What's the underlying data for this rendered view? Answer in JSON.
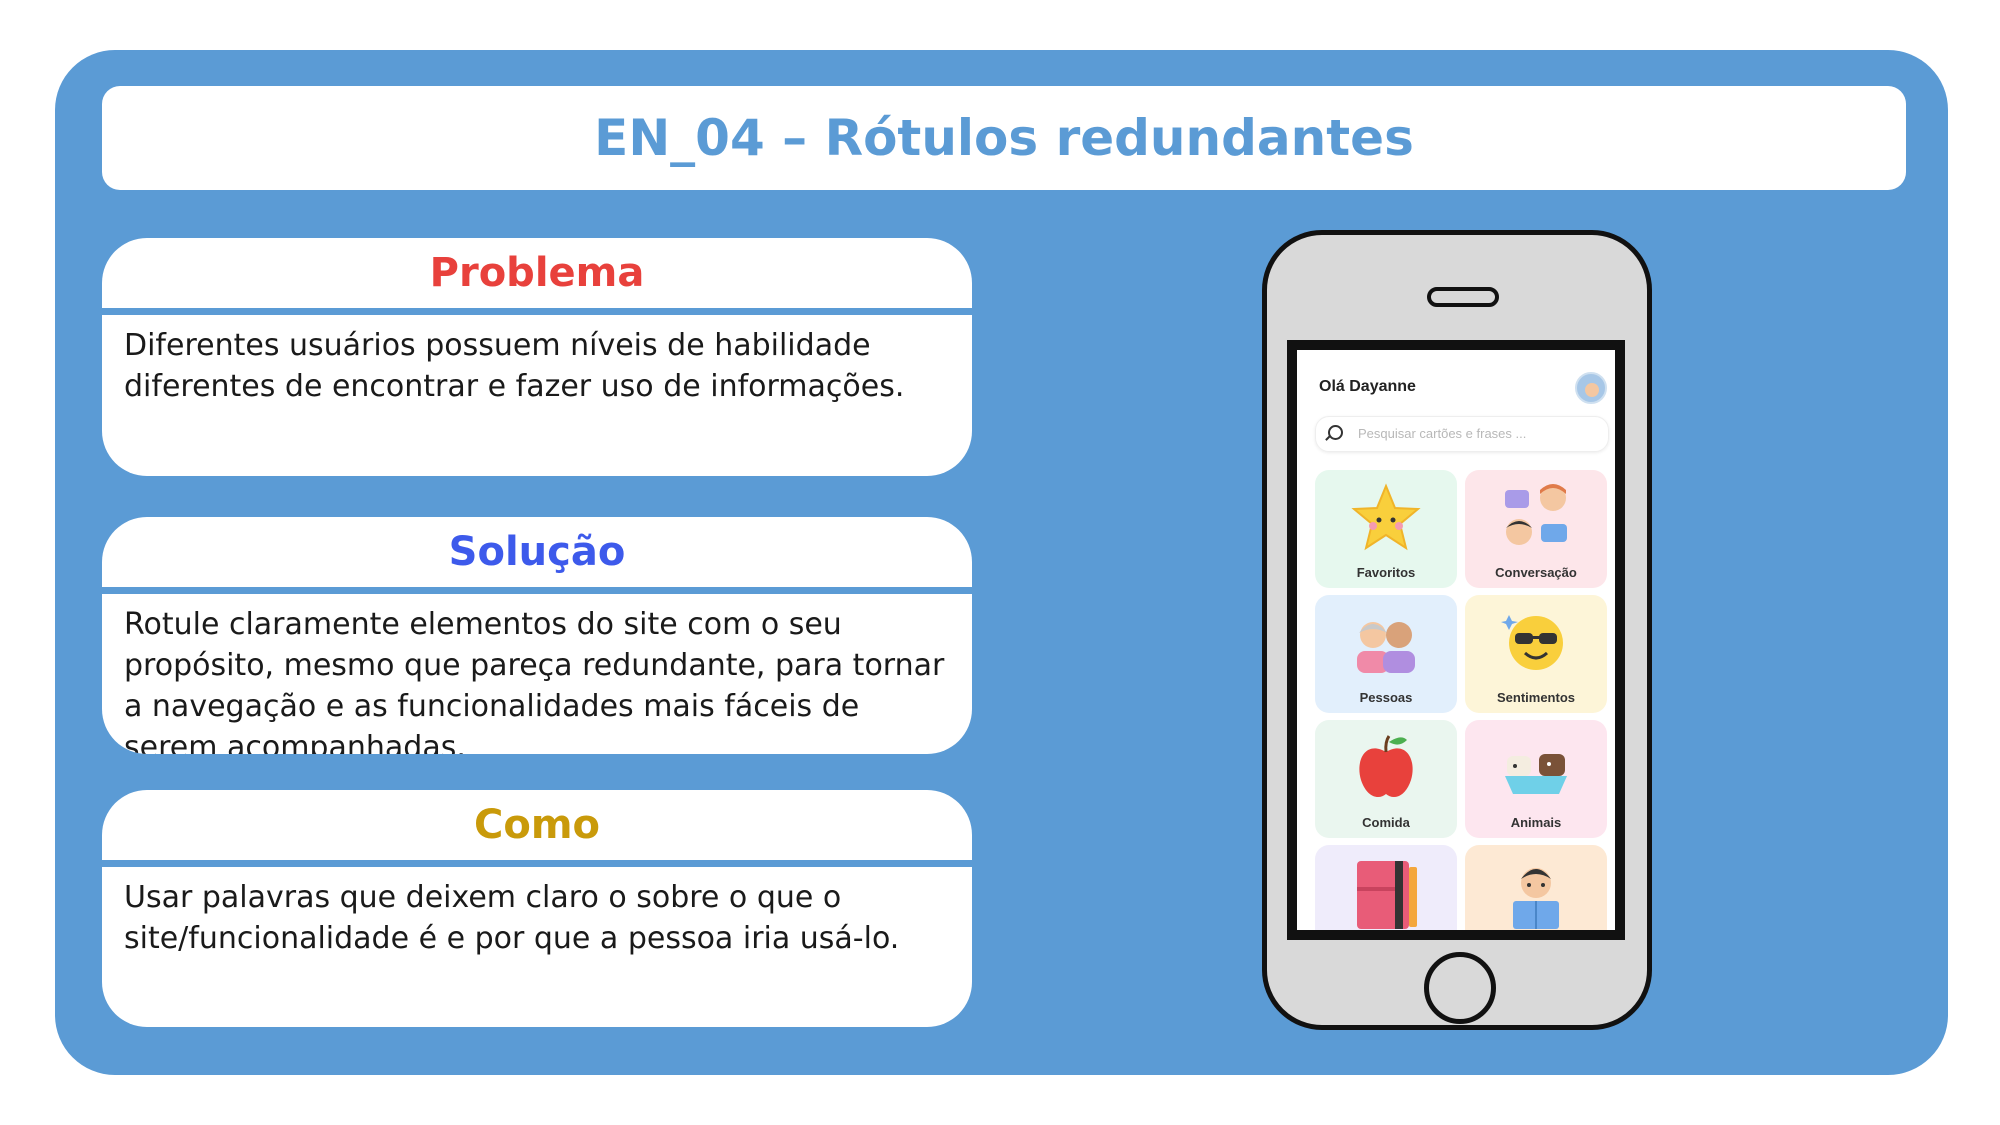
{
  "title": "EN_04 – Rótulos redundantes",
  "cards": [
    {
      "heading": "Problema",
      "color": "#e8413c",
      "text": "Diferentes usuários possuem níveis de habilidade diferentes de encontrar e fazer uso de informações."
    },
    {
      "heading": "Solução",
      "color": "#3d5aeb",
      "text": "Rotule claramente elementos do site com o seu propósito, mesmo que pareça redundante, para tornar a navegação e as funcionalidades mais fáceis de serem acompanhadas."
    },
    {
      "heading": "Como",
      "color": "#c99a0a",
      "text": "Usar palavras que deixem claro o sobre o que o site/funcionalidade é e por que a pessoa iria usá-lo."
    }
  ],
  "phone": {
    "greeting": "Olá Dayanne",
    "search_placeholder": "Pesquisar cartões e frases ...",
    "categories": [
      {
        "label": "Favoritos",
        "bg": "#e6f8ee",
        "icon": "star-icon"
      },
      {
        "label": "Conversação",
        "bg": "#fde6ea",
        "icon": "conversation-icon"
      },
      {
        "label": "Pessoas",
        "bg": "#e2effc",
        "icon": "people-icon"
      },
      {
        "label": "Sentimentos",
        "bg": "#fdf5d8",
        "icon": "feelings-icon"
      },
      {
        "label": "Comida",
        "bg": "#eaf6ef",
        "icon": "apple-icon"
      },
      {
        "label": "Animais",
        "bg": "#fde6ef",
        "icon": "animals-icon"
      },
      {
        "label": "",
        "bg": "#efecfb",
        "icon": "book-icon"
      },
      {
        "label": "",
        "bg": "#fde9d4",
        "icon": "reader-icon"
      }
    ]
  },
  "colors": {
    "panel": "#5b9bd5",
    "card": "#ffffff"
  }
}
